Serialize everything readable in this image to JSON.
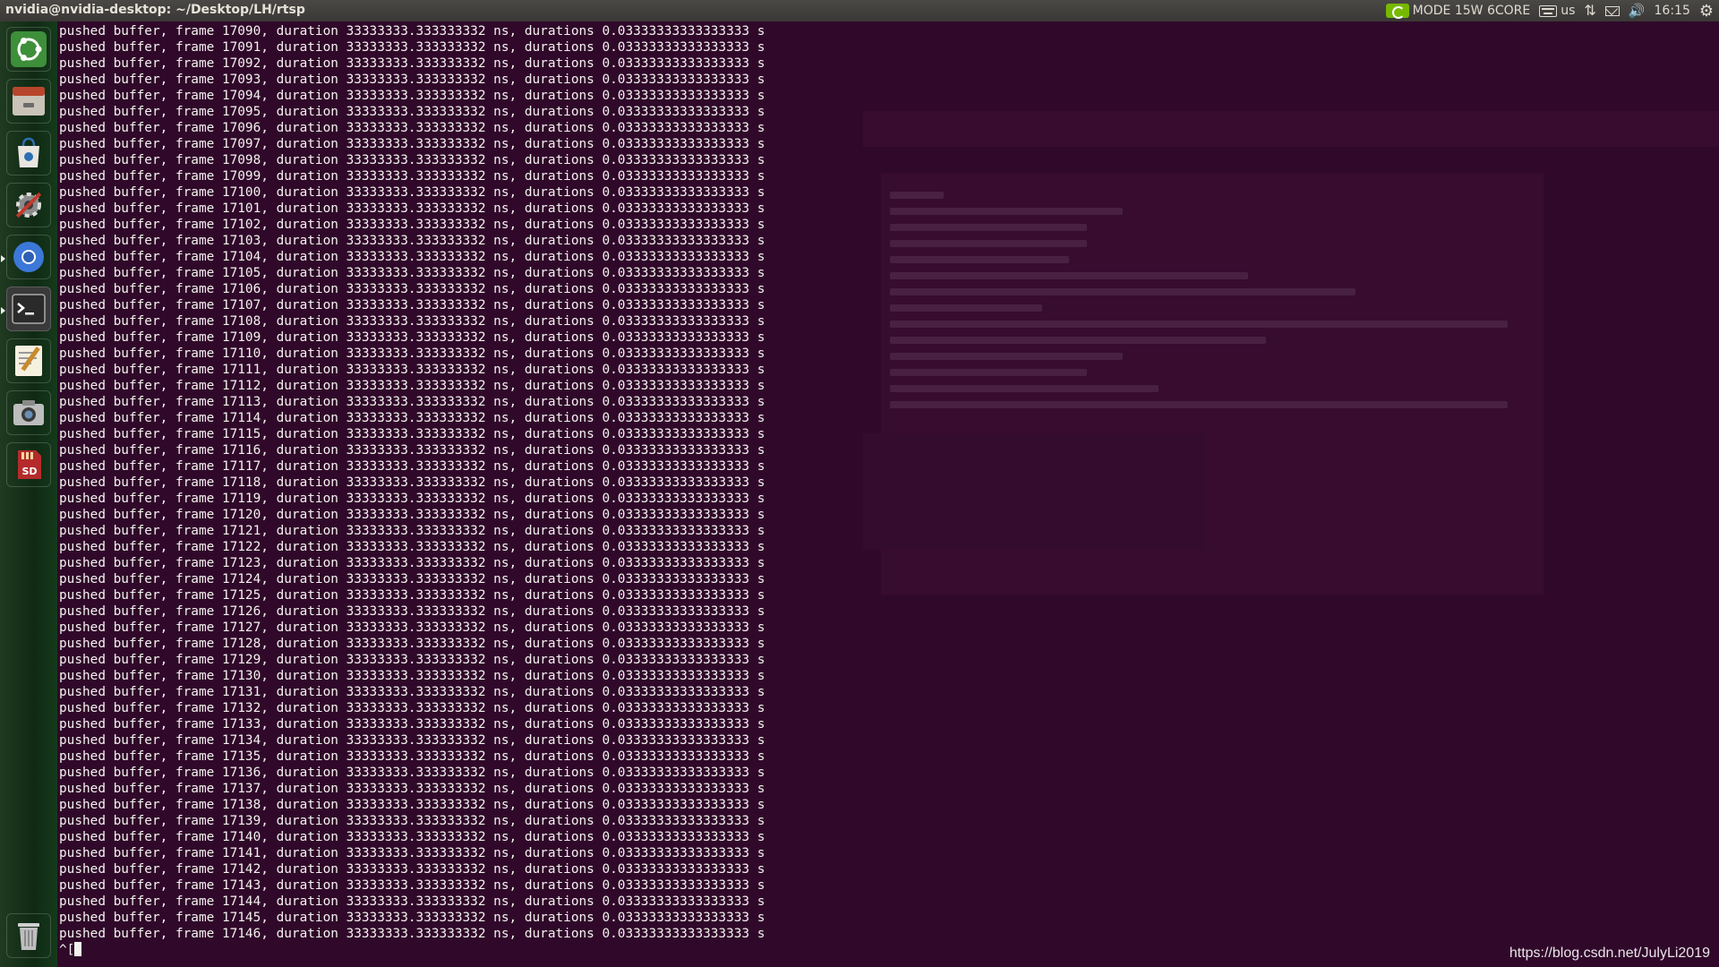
{
  "topbar": {
    "window_title": "nvidia@nvidia-desktop: ~/Desktop/LH/rtsp",
    "power_mode": "MODE 15W 6CORE",
    "keyboard_layout": "us",
    "clock": "16:15"
  },
  "launcher": {
    "items": [
      {
        "name": "ubuntu-home-icon",
        "color": "#3d8f3a"
      },
      {
        "name": "files-icon",
        "color": "#b7452b"
      },
      {
        "name": "software-center-icon",
        "color": "#2d6fb4"
      },
      {
        "name": "system-settings-icon",
        "color": "#7a7a7a"
      },
      {
        "name": "chromium-icon",
        "color": "#2d5fb3"
      },
      {
        "name": "terminal-icon",
        "color": "#2e2e2e"
      },
      {
        "name": "text-editor-icon",
        "color": "#c98a2c"
      },
      {
        "name": "screenshot-camera-icon",
        "color": "#8a8a8a"
      },
      {
        "name": "sd-card-icon",
        "color": "#a12828"
      },
      {
        "name": "trash-icon",
        "color": "#6c6c6c"
      }
    ]
  },
  "terminal": {
    "line_prefix": "pushed buffer, frame ",
    "line_suffix": ", duration 33333333.333333332 ns, durations 0.03333333333333333 s",
    "frames": [
      "17090",
      "17091",
      "17092",
      "17093",
      "17094",
      "17095",
      "17096",
      "17097",
      "17098",
      "17099",
      "17100",
      "17101",
      "17102",
      "17103",
      "17104",
      "17105",
      "17106",
      "17107",
      "17108",
      "17109",
      "17110",
      "17111",
      "17112",
      "17113",
      "17114",
      "17115",
      "17116",
      "17117",
      "17118",
      "17119",
      "17120",
      "17121",
      "17122",
      "17123",
      "17124",
      "17125",
      "17126",
      "17127",
      "17128",
      "17129",
      "17130",
      "17131",
      "17132",
      "17133",
      "17134",
      "17135",
      "17136",
      "17137",
      "17138",
      "17139",
      "17140",
      "17141",
      "17142",
      "17143",
      "17144",
      "17145",
      "17146"
    ],
    "prompt_tail": "^["
  },
  "watermark": "https://blog.csdn.net/JulyLi2019",
  "colors": {
    "terminal_bg": "#30092a",
    "terminal_fg": "#f4f2ef",
    "topbar_bg": "#3c3b37",
    "launcher_bg": "#17331b"
  }
}
